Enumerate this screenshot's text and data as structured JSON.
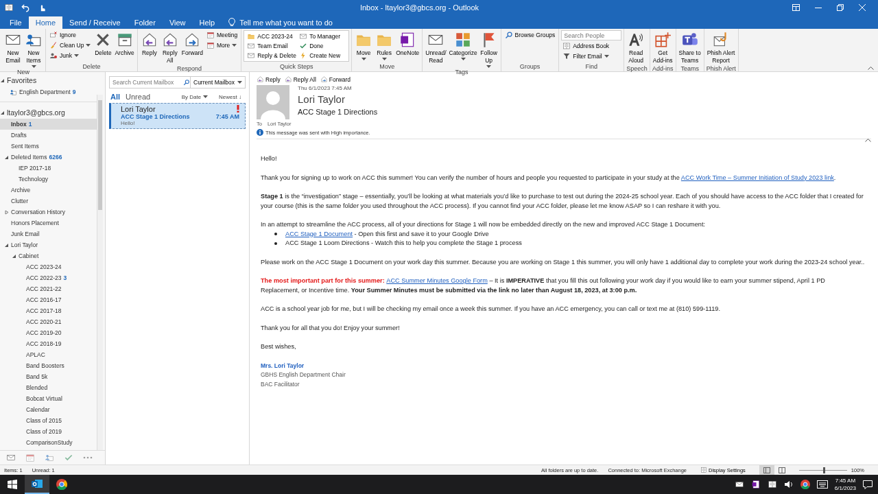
{
  "window": {
    "title": "Inbox - ltaylor3@gbcs.org - Outlook"
  },
  "menu_tabs": [
    {
      "label": "File",
      "selected": false
    },
    {
      "label": "Home",
      "selected": true
    },
    {
      "label": "Send / Receive",
      "selected": false
    },
    {
      "label": "Folder",
      "selected": false
    },
    {
      "label": "View",
      "selected": false
    },
    {
      "label": "Help",
      "selected": false
    }
  ],
  "tell_me": "Tell me what you want to do",
  "ribbon": [
    {
      "label": "New",
      "items": [
        {
          "kind": "large",
          "label": "New\nEmail",
          "dropdown": false
        },
        {
          "kind": "large",
          "label": "New\nItems",
          "dropdown": true
        }
      ]
    },
    {
      "label": "Delete",
      "items": [
        {
          "kind": "small",
          "label": "Ignore",
          "dropdown": false
        },
        {
          "kind": "small",
          "label": "Clean Up",
          "dropdown": true
        },
        {
          "kind": "small",
          "label": "Junk",
          "dropdown": true
        },
        {
          "kind": "large",
          "label": "Delete",
          "dropdown": false
        },
        {
          "kind": "large",
          "label": "Archive",
          "dropdown": false
        }
      ]
    },
    {
      "label": "Respond",
      "items": [
        {
          "kind": "large",
          "label": "Reply",
          "dropdown": false
        },
        {
          "kind": "large",
          "label": "Reply\nAll",
          "dropdown": false
        },
        {
          "kind": "large",
          "label": "Forward",
          "dropdown": false
        },
        {
          "kind": "small",
          "label": "Meeting",
          "dropdown": false
        },
        {
          "kind": "small",
          "label": "More",
          "dropdown": true
        }
      ]
    },
    {
      "label": "Quick Steps",
      "items": [
        {
          "kind": "gallery",
          "label": "ACC 2023-24"
        },
        {
          "kind": "gallery",
          "label": "To Manager"
        },
        {
          "kind": "gallery",
          "label": "Team Email"
        },
        {
          "kind": "gallery",
          "label": "Done"
        },
        {
          "kind": "gallery",
          "label": "Reply & Delete"
        },
        {
          "kind": "gallery",
          "label": "Create New"
        }
      ]
    },
    {
      "label": "Move",
      "items": [
        {
          "kind": "large",
          "label": "Move",
          "dropdown": true
        },
        {
          "kind": "large",
          "label": "Rules",
          "dropdown": true
        },
        {
          "kind": "large",
          "label": "OneNote",
          "dropdown": false
        }
      ]
    },
    {
      "label": "Tags",
      "items": [
        {
          "kind": "large",
          "label": "Unread/\nRead",
          "dropdown": false
        },
        {
          "kind": "large",
          "label": "Categorize",
          "dropdown": true
        },
        {
          "kind": "large",
          "label": "Follow\nUp",
          "dropdown": true
        }
      ]
    },
    {
      "label": "Groups",
      "items": [
        {
          "kind": "small",
          "label": "Browse Groups",
          "dropdown": false
        }
      ]
    },
    {
      "label": "Find",
      "items": [
        {
          "kind": "field",
          "placeholder": "Search People"
        },
        {
          "kind": "small",
          "label": "Address Book",
          "dropdown": false
        },
        {
          "kind": "small",
          "label": "Filter Email",
          "dropdown": true
        }
      ]
    },
    {
      "label": "Speech",
      "items": [
        {
          "kind": "large",
          "label": "Read\nAloud",
          "dropdown": false
        }
      ]
    },
    {
      "label": "Add-ins",
      "items": [
        {
          "kind": "large",
          "label": "Get\nAdd-ins",
          "dropdown": false
        }
      ]
    },
    {
      "label": "Teams",
      "items": [
        {
          "kind": "large",
          "label": "Share to\nTeams",
          "dropdown": false
        }
      ]
    },
    {
      "label": "Phish Alert",
      "items": [
        {
          "kind": "large",
          "label": "Phish Alert\nReport",
          "dropdown": false
        }
      ]
    }
  ],
  "favorites": {
    "title": "Favorites",
    "items": [
      {
        "name": "English Department",
        "count": "9"
      }
    ]
  },
  "account": {
    "name": "ltaylor3@gbcs.org",
    "expanded": true,
    "folders": [
      {
        "name": "Inbox",
        "count": "1",
        "selected": true
      },
      {
        "name": "Drafts",
        "selected": false
      },
      {
        "name": "Sent Items",
        "selected": false
      },
      {
        "name": "Deleted Items",
        "count": "6266",
        "selected": false,
        "expanded": true,
        "children": [
          {
            "name": "IEP 2017-18",
            "selected": false
          },
          {
            "name": "Technology",
            "selected": false
          }
        ]
      },
      {
        "name": "Archive",
        "selected": false
      },
      {
        "name": "Clutter",
        "selected": false
      },
      {
        "name": "Conversation History",
        "selected": false,
        "expanded": false
      },
      {
        "name": "Honors Placement",
        "selected": false
      },
      {
        "name": "Junk Email",
        "selected": false
      },
      {
        "name": "Lori Taylor",
        "selected": false,
        "expanded": true,
        "children": [
          {
            "name": "Cabinet",
            "selected": false,
            "expanded": true,
            "children": [
              {
                "name": "ACC 2023-24",
                "selected": false
              },
              {
                "name": "ACC 2022-23",
                "count": "3",
                "selected": false
              },
              {
                "name": "ACC 2021-22",
                "selected": false
              },
              {
                "name": "ACC 2016-17",
                "selected": false
              },
              {
                "name": "ACC 2017-18",
                "selected": false
              },
              {
                "name": "ACC 2020-21",
                "selected": false
              },
              {
                "name": "ACC 2019-20",
                "selected": false
              },
              {
                "name": "ACC 2018-19",
                "selected": false
              },
              {
                "name": "APLAC",
                "selected": false
              },
              {
                "name": "Band Boosters",
                "selected": false
              },
              {
                "name": "Band 5k",
                "selected": false
              },
              {
                "name": "Blended",
                "selected": false
              },
              {
                "name": "Bobcat Virtual",
                "selected": false
              },
              {
                "name": "Calendar",
                "selected": false
              },
              {
                "name": "Class of 2015",
                "selected": false
              },
              {
                "name": "Class of 2019",
                "selected": false
              },
              {
                "name": "ComparisonStudy",
                "selected": false
              }
            ]
          }
        ]
      }
    ]
  },
  "nav": [
    {
      "selected": true
    },
    {
      "selected": false
    },
    {
      "selected": false
    },
    {
      "selected": false
    },
    {
      "selected": false
    }
  ],
  "message_list": {
    "search_placeholder": "Search Current Mailbox",
    "scope": "Current Mailbox",
    "filters": [
      {
        "label": "All",
        "selected": true
      },
      {
        "label": "Unread",
        "selected": false
      }
    ],
    "sort": "By Date",
    "order": "Newest ↓",
    "messages": [
      {
        "sender": "Lori Taylor",
        "subject": "ACC Stage 1 Directions",
        "time": "7:45 AM",
        "preview": "Hello!",
        "high_importance": true,
        "unread": true,
        "selected": true
      }
    ]
  },
  "reading_pane": {
    "actions": [
      "Reply",
      "Reply All",
      "Forward"
    ],
    "date": "Thu 6/1/2023 7:45 AM",
    "sender": "Lori Taylor",
    "subject": "ACC Stage 1 Directions",
    "to_label": "To",
    "to": "Lori Taylor",
    "notice": "This message was sent with High importance.",
    "body": [
      {
        "kind": "p",
        "parts": [
          {
            "kind": "text",
            "text": "Hello!"
          }
        ]
      },
      {
        "kind": "p",
        "parts": [
          {
            "kind": "text",
            "text": "Thank you for signing up to work on ACC this summer! You can verify the number of hours and people you requested to participate in your study at the "
          },
          {
            "kind": "link",
            "text": "ACC Work Time – Summer Initiation of Study 2023 link"
          },
          {
            "kind": "text",
            "text": "."
          }
        ]
      },
      {
        "kind": "p",
        "parts": [
          {
            "kind": "bold",
            "text": "Stage 1"
          },
          {
            "kind": "text",
            "text": " is the “investigation” stage – essentially, you’ll be looking at what materials you’d like to purchase to test out during the 2024-25 school year.  Each of you should have access to the ACC folder that I created for your course (this is the same folder you used throughout the ACC process). If you cannot find your ACC folder, please let me know ASAP so I can reshare it with you."
          }
        ]
      },
      {
        "kind": "p",
        "parts": [
          {
            "kind": "text",
            "text": "In an attempt to streamline the ACC process, all of your directions for Stage 1 will now be embedded directly on the new and improved ACC Stage 1 Document:"
          }
        ],
        "bullets": [
          [
            {
              "kind": "link",
              "text": "ACC Stage 1 Document"
            },
            {
              "kind": "text",
              "text": " - Open this first and save it to your Google Drive"
            }
          ],
          [
            {
              "kind": "text",
              "text": "ACC Stage 1 Loom Directions - Watch this to help you complete the Stage 1 process"
            }
          ]
        ]
      },
      {
        "kind": "p",
        "parts": [
          {
            "kind": "text",
            "text": "Please work on the ACC Stage 1 Document on your work day this summer. Because you are working on Stage 1 this summer, you will only have 1 additional day to complete your work during the 2023-24 school year.."
          }
        ]
      },
      {
        "kind": "p",
        "parts": [
          {
            "kind": "alert",
            "text": "The most important part for this summer: "
          },
          {
            "kind": "link",
            "text": "ACC Summer Minutes Google Form"
          },
          {
            "kind": "text",
            "text": " – It is "
          },
          {
            "kind": "bold",
            "text": "IMPERATIVE"
          },
          {
            "kind": "text",
            "text": " that you fill this out following your work day if you would like to earn your summer stipend, April 1 PD Replacement, or Incentive time. "
          },
          {
            "kind": "bold",
            "text": "Your Summer Minutes must be submitted via the link no later than August 18, 2023, at 3:00 p.m."
          }
        ]
      },
      {
        "kind": "p",
        "parts": [
          {
            "kind": "text",
            "text": "ACC is a school year job for me, but I will be checking my email once a week this summer. If you have an ACC emergency, you can call or text me at (810) 599-1119."
          }
        ]
      },
      {
        "kind": "p",
        "parts": [
          {
            "kind": "text",
            "text": "Thank you for all that you do! Enjoy your summer!"
          }
        ]
      },
      {
        "kind": "p",
        "parts": [
          {
            "kind": "text",
            "text": "Best wishes,"
          }
        ]
      },
      {
        "kind": "signature",
        "lines": [
          "Mrs. Lori Taylor",
          "GBHS English Department Chair",
          "BAC Facilitator"
        ]
      }
    ]
  },
  "status_bar": {
    "left": [
      "Items: 1",
      "Unread: 1"
    ],
    "right": [
      "All folders are up to date.",
      "Connected to: Microsoft Exchange"
    ],
    "display_settings": "Display Settings",
    "views": [
      {
        "selected": true
      },
      {
        "selected": false
      }
    ],
    "zoom": {
      "level": 0.5,
      "reading": "100%"
    }
  },
  "taskbar": {
    "apps": [
      {
        "selected": true
      },
      {
        "selected": false
      }
    ],
    "time": "7:45 AM",
    "date": "6/1/2023"
  }
}
